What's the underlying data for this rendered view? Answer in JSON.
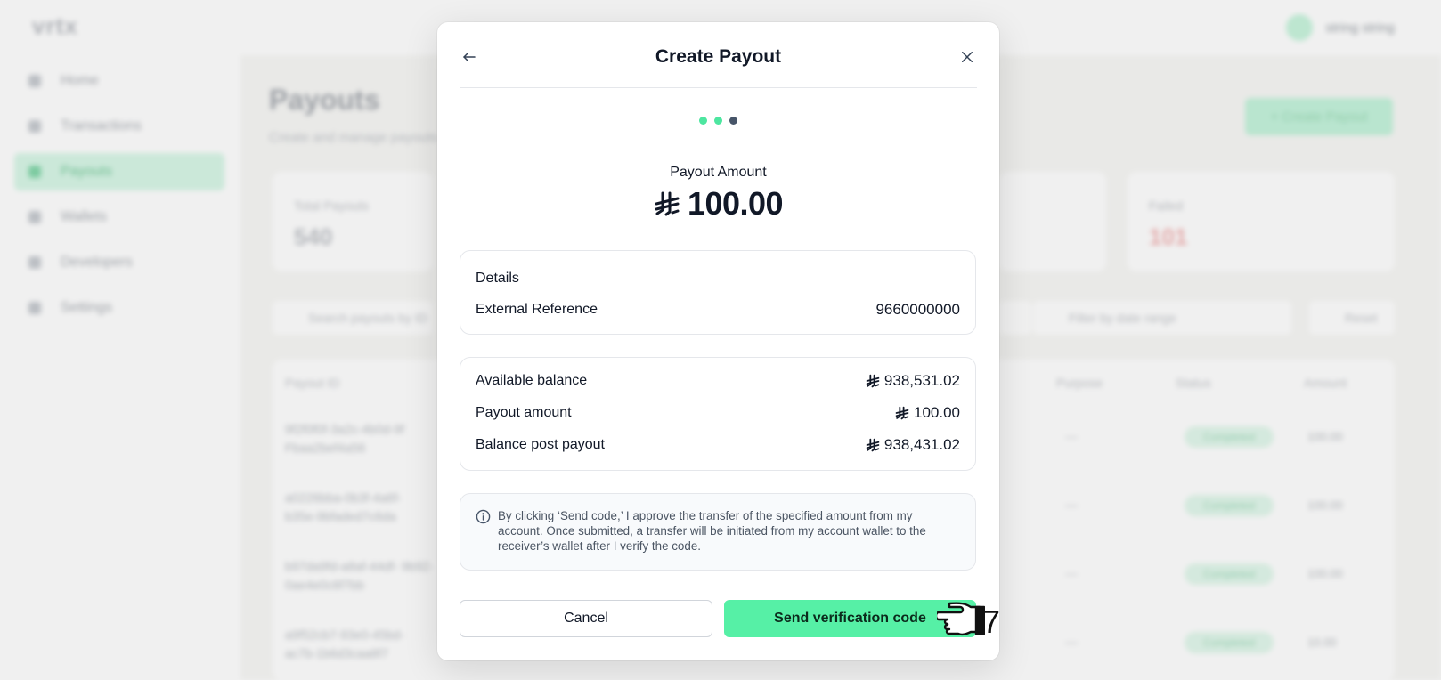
{
  "background": {
    "logo": "vrtx",
    "user_name": "string string",
    "sidebar": [
      {
        "label": "Home",
        "active": false
      },
      {
        "label": "Transactions",
        "active": false
      },
      {
        "label": "Payouts",
        "active": true
      },
      {
        "label": "Wallets",
        "active": false
      },
      {
        "label": "Developers",
        "active": false
      },
      {
        "label": "Settings",
        "active": false
      }
    ],
    "page_title": "Payouts",
    "page_subtitle": "Create and manage payouts",
    "create_button": "+ Create Payout",
    "stats": [
      {
        "label": "Total Payouts",
        "value": "540"
      },
      {
        "label": "Failed",
        "value": "101"
      }
    ],
    "search_placeholder": "Search payouts by ID",
    "date_placeholder": "Filter by date range",
    "reset_label": "Reset",
    "columns": [
      "Payout ID",
      "Purpose",
      "Status",
      "Amount"
    ],
    "rows": [
      {
        "id": "9f2f0f0f-3a2c-4b0d-9f Fbaa2bef4a56",
        "purpose": "—",
        "status": "Completed",
        "amount": "100.00"
      },
      {
        "id": "a0226bba-0b3f-4a6f- b35e-9bfaded7c6da",
        "purpose": "—",
        "status": "Completed",
        "amount": "100.00"
      },
      {
        "id": "b97da9fd-a8af-44df- 9b92-0ae4e0c6f7bb",
        "purpose": "—",
        "status": "Completed",
        "amount": "100.00"
      },
      {
        "id": "a9f52cb7-93e0-45bd- ac7b-1b6d3caa8f7",
        "purpose": "—",
        "status": "Completed",
        "amount": "10.00"
      }
    ]
  },
  "modal": {
    "title": "Create Payout",
    "steps_total": 3,
    "steps_completed": 2,
    "amount_label": "Payout Amount",
    "amount_value": "100.00",
    "details": {
      "heading": "Details",
      "external_reference_label": "External Reference",
      "external_reference_value": "9660000000"
    },
    "balances": {
      "available_label": "Available balance",
      "available_value": "938,531.02",
      "payout_label": "Payout amount",
      "payout_value": "100.00",
      "post_label": "Balance post payout",
      "post_value": "938,431.02"
    },
    "info_text": "By clicking ‘Send code,’ I approve the transfer of the specified amount from my account. Once submitted, a transfer will be initiated from my account wallet to the receiver’s wallet after I verify the code.",
    "cancel_label": "Cancel",
    "send_label": "Send verification code"
  },
  "cursor_label": "7",
  "icons": {
    "back": "arrow-left-icon",
    "close": "close-icon",
    "currency": "saudi-riyal-icon",
    "info": "info-icon",
    "cursor": "pointer-hand-icon"
  },
  "colors": {
    "accent": "#56f0a6",
    "step_current": "#475569"
  }
}
